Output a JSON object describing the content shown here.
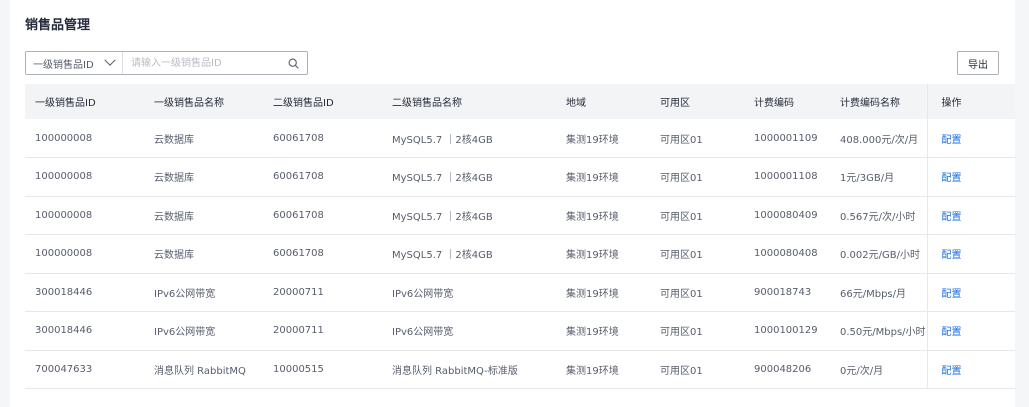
{
  "page": {
    "title": "销售品管理"
  },
  "filter": {
    "select_value": "一级销售品ID",
    "search_placeholder": "请输入一级销售品ID",
    "search_icon": "search-icon"
  },
  "toolbar": {
    "export_label": "导出"
  },
  "table": {
    "columns": [
      "一级销售品ID",
      "一级销售品名称",
      "二级销售品ID",
      "二级销售品名称",
      "地域",
      "可用区",
      "计费编码",
      "计费编码名称",
      "操作"
    ],
    "rows": [
      [
        "100000008",
        "云数据库",
        "60061708",
        "MySQL5.7 ｜2核4GB",
        "集测19环境",
        "可用区01",
        "1000001109",
        "408.000元/次/月",
        "配置"
      ],
      [
        "100000008",
        "云数据库",
        "60061708",
        "MySQL5.7 ｜2核4GB",
        "集测19环境",
        "可用区01",
        "1000001108",
        "1元/3GB/月",
        "配置"
      ],
      [
        "100000008",
        "云数据库",
        "60061708",
        "MySQL5.7 ｜2核4GB",
        "集测19环境",
        "可用区01",
        "1000080409",
        "0.567元/次/小时",
        "配置"
      ],
      [
        "100000008",
        "云数据库",
        "60061708",
        "MySQL5.7 ｜2核4GB",
        "集测19环境",
        "可用区01",
        "1000080408",
        "0.002元/GB/小时",
        "配置"
      ],
      [
        "300018446",
        "IPv6公网带宽",
        "20000711",
        "IPv6公网带宽",
        "集测19环境",
        "可用区01",
        "900018743",
        "66元/Mbps/月",
        "配置"
      ],
      [
        "300018446",
        "IPv6公网带宽",
        "20000711",
        "IPv6公网带宽",
        "集测19环境",
        "可用区01",
        "1000100129",
        "0.50元/Mbps/小时",
        "配置"
      ],
      [
        "700047633",
        "消息队列 RabbitMQ",
        "10000515",
        "消息队列 RabbitMQ-标准版",
        "集测19环境",
        "可用区01",
        "900048206",
        "0元/次/月",
        "配置"
      ]
    ]
  },
  "colors": {
    "link": "#1a6fe0",
    "header_bg": "#f3f4f6",
    "border": "#e6e8ec"
  }
}
